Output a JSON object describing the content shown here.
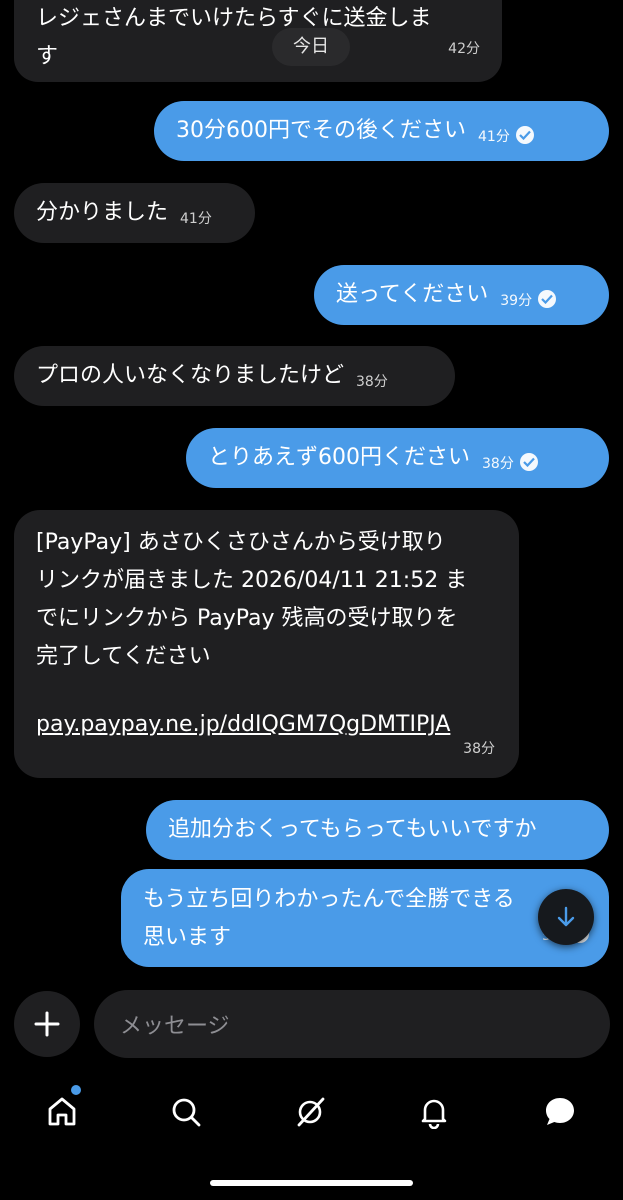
{
  "date_chip": "今日",
  "messages": [
    {
      "id": "m0",
      "dir": "in",
      "text_lines": [
        "レジェさんまでいけたらすぐに送金しま",
        "す"
      ],
      "time": "42分"
    },
    {
      "id": "m1",
      "dir": "out",
      "text": "30分600円でその後ください",
      "time": "41分",
      "read": true
    },
    {
      "id": "m2",
      "dir": "in",
      "text": "分かりました",
      "time": "41分"
    },
    {
      "id": "m3",
      "dir": "out",
      "text": "送ってください",
      "time": "39分",
      "read": true
    },
    {
      "id": "m4",
      "dir": "in",
      "text": "プロの人いなくなりましたけど",
      "time": "38分"
    },
    {
      "id": "m5",
      "dir": "out",
      "text": "とりあえず600円ください",
      "time": "38分",
      "read": true
    },
    {
      "id": "m6",
      "dir": "in",
      "text_lines": [
        "[PayPay] あさひくさひさんから受け取り",
        "リンクが届きました 2026/04/11 21:52 ま",
        "でにリンクから PayPay 残高の受け取りを",
        "完了してください"
      ],
      "link": "pay.paypay.ne.jp/ddIQGM7QgDMTIPJA",
      "time": "38分"
    },
    {
      "id": "m7",
      "dir": "out",
      "text": "追加分おくってもらってもいいですか"
    },
    {
      "id": "m8",
      "dir": "out",
      "text_lines": [
        "もう立ち回りわかったんで全勝できる",
        "思います"
      ],
      "time": "5分",
      "read": true
    }
  ],
  "composer": {
    "placeholder": "メッセージ"
  },
  "nav": {
    "items": [
      "home",
      "search",
      "grok",
      "notifications",
      "messages"
    ],
    "accent": "#4a9be8"
  }
}
